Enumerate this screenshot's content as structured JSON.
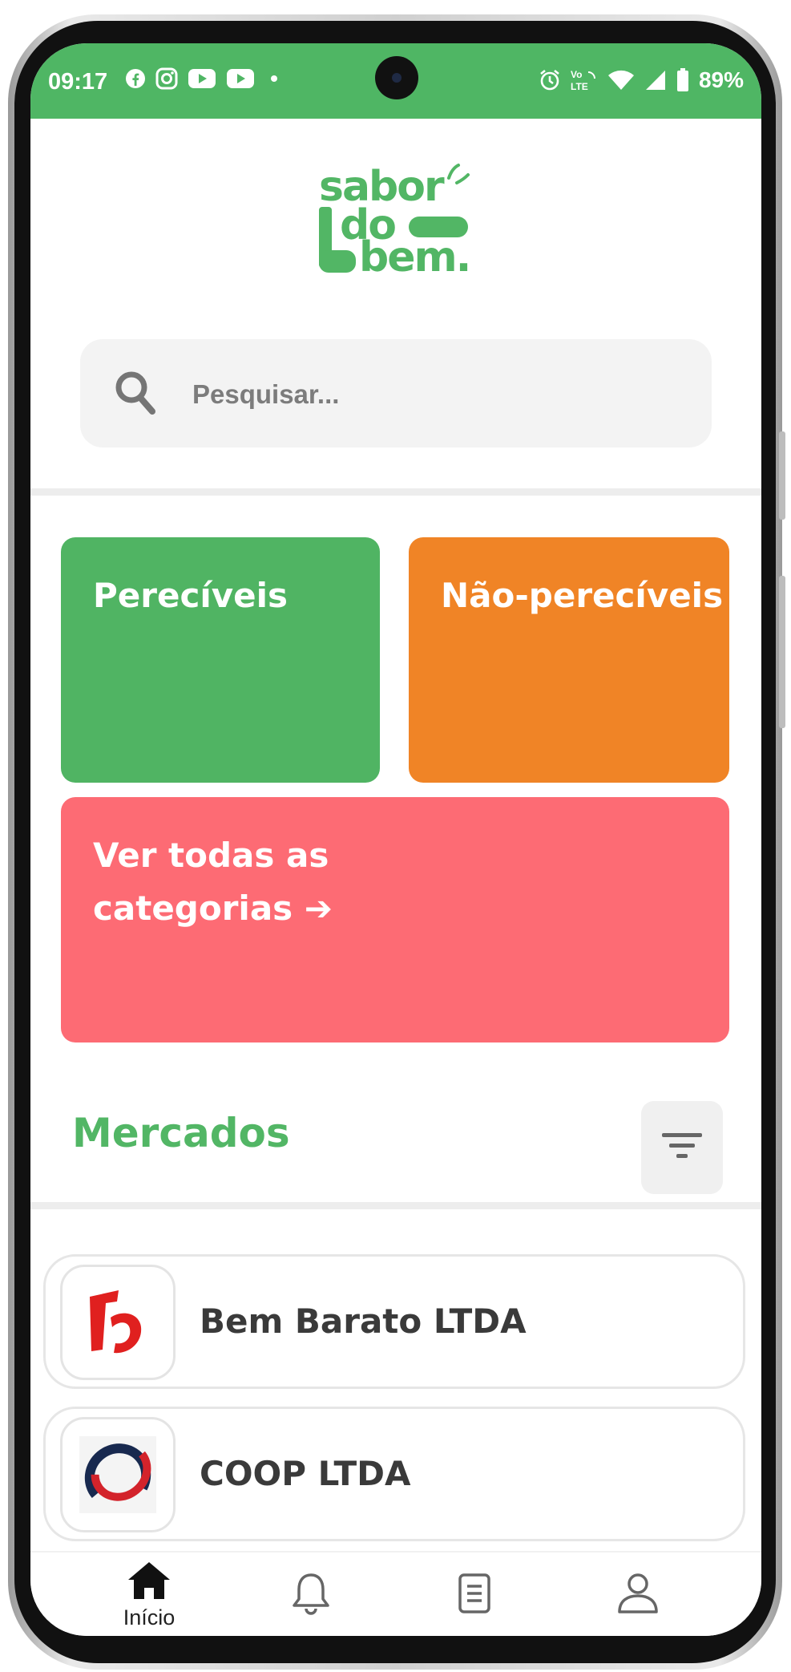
{
  "status_bar": {
    "time": "09:17",
    "battery": "89%",
    "left_icons": [
      "facebook-icon",
      "instagram-icon",
      "youtube-icon",
      "youtube-icon",
      "dot-icon"
    ],
    "right_icons": [
      "alarm-icon",
      "volte-icon",
      "wifi-icon",
      "signal-icon",
      "battery-icon"
    ]
  },
  "logo": {
    "lines": [
      "sabor",
      "do",
      "bem."
    ],
    "color": "#52b665"
  },
  "search": {
    "placeholder": "Pesquisar..."
  },
  "categories": {
    "pereciveis": {
      "label": "Perecíveis",
      "color": "#50b463"
    },
    "nao_pereciveis": {
      "label": "Não-perecíveis",
      "color": "#f08426"
    },
    "all": {
      "line1": "Ver todas as",
      "line2": "categorias",
      "arrow": "➔",
      "color": "#fd6b74"
    }
  },
  "markets_section": {
    "title": "Mercados",
    "filter_icon": "filter-icon"
  },
  "markets": [
    {
      "name": "Bem Barato LTDA",
      "logo_icon": "bem-barato-logo"
    },
    {
      "name": "COOP LTDA",
      "logo_icon": "coop-logo"
    }
  ],
  "bottom_nav": {
    "items": [
      {
        "label": "Início",
        "icon": "home-icon",
        "active": true
      },
      {
        "label": "",
        "icon": "bell-icon",
        "active": false
      },
      {
        "label": "",
        "icon": "document-icon",
        "active": false
      },
      {
        "label": "",
        "icon": "user-icon",
        "active": false
      }
    ]
  },
  "colors": {
    "brand_green": "#4fb664",
    "accent_orange": "#f08426",
    "accent_red": "#fd6b74"
  }
}
